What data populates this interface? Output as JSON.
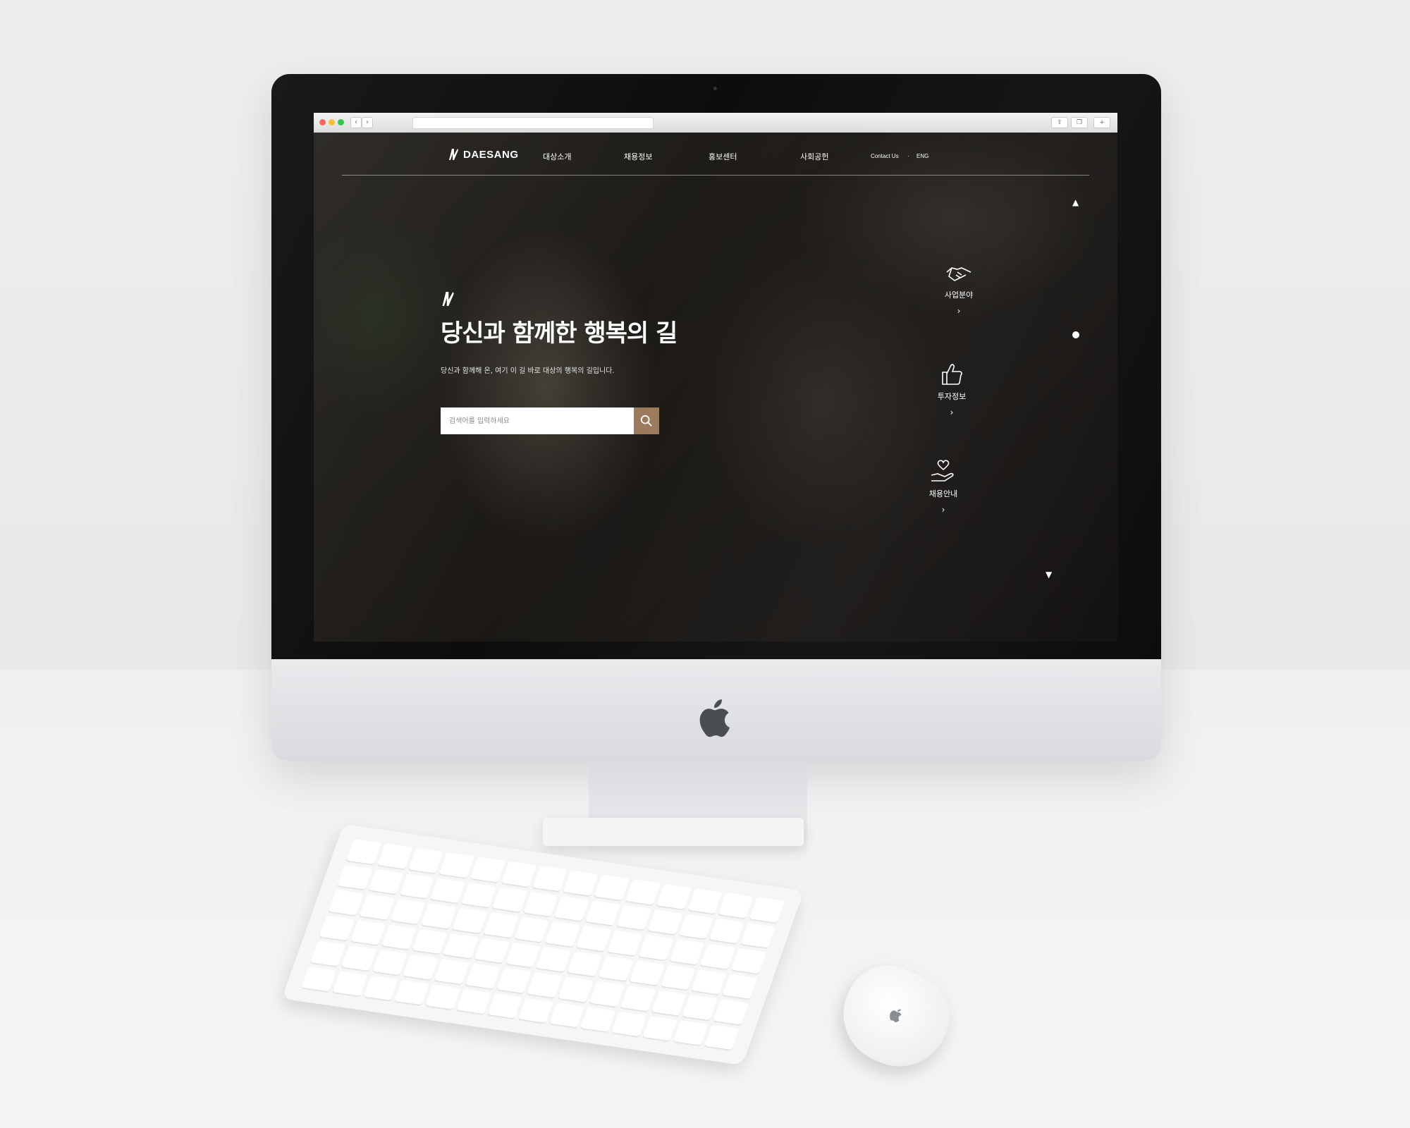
{
  "brand": {
    "name": "DAESANG"
  },
  "gnb": [
    "대상소개",
    "채용정보",
    "홍보센터",
    "사회공헌"
  ],
  "utility": {
    "contact": "Contact Us",
    "separator": "·",
    "lang": "ENG"
  },
  "hero": {
    "headline": "당신과 함께한 행복의 길",
    "subcopy": "당신과 함께해 온, 여기 이 길 바로 대상의 행복의 길입니다.",
    "search_placeholder": "검색어를 입력하세요"
  },
  "quick_links": [
    {
      "label": "사업분야",
      "icon": "handshake-icon",
      "arrow": "›"
    },
    {
      "label": "투자정보",
      "icon": "thumbs-up-icon",
      "arrow": "›"
    },
    {
      "label": "채용안내",
      "icon": "heart-hand-icon",
      "arrow": "›"
    }
  ],
  "colors": {
    "accent": "#9b7a5c",
    "overlay": "#2a2622"
  }
}
